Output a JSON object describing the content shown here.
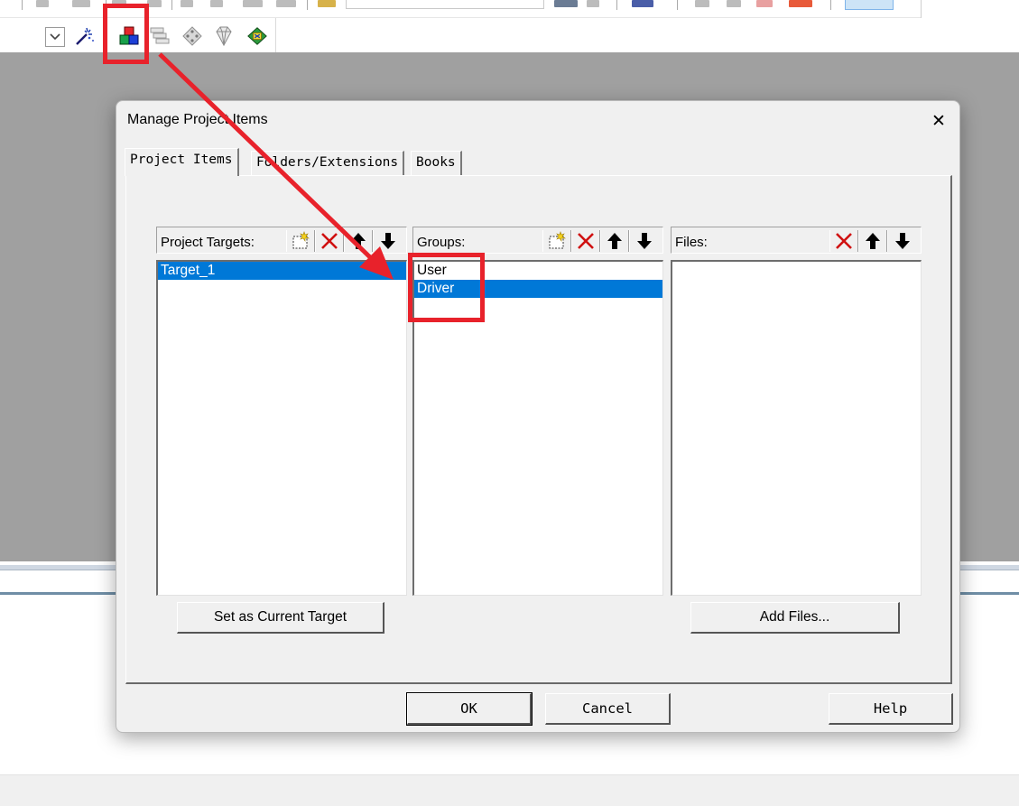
{
  "toolbar": {
    "icons": [
      "new-project-icon-faded",
      "cut-icon-faded",
      "combo-box",
      "manage-project-items-icon",
      "batch-build-icon",
      "target-options-icon",
      "pack-installer-icon",
      "select-packs-icon"
    ]
  },
  "dialog": {
    "title": "Manage Project Items",
    "close_label": "✕",
    "tabs": [
      {
        "label": "Project Items",
        "active": true
      },
      {
        "label": "Folders/Extensions",
        "active": false
      },
      {
        "label": "Books",
        "active": false
      }
    ],
    "targets": {
      "label": "Project Targets:",
      "items": [
        {
          "text": "Target_1",
          "selected": true
        }
      ]
    },
    "groups": {
      "label": "Groups:",
      "items": [
        {
          "text": "User",
          "selected": false
        },
        {
          "text": "Driver",
          "selected": true
        }
      ]
    },
    "files": {
      "label": "Files:",
      "items": []
    },
    "set_current_target_label": "Set as Current Target",
    "add_files_label": "Add Files...",
    "ok_label": "OK",
    "cancel_label": "Cancel",
    "help_label": "Help"
  },
  "colors": {
    "annotation_red": "#e8222b",
    "selection_blue": "#0078d7",
    "workspace_gray": "#a0a0a0",
    "dialog_face": "#f0f0f0"
  }
}
